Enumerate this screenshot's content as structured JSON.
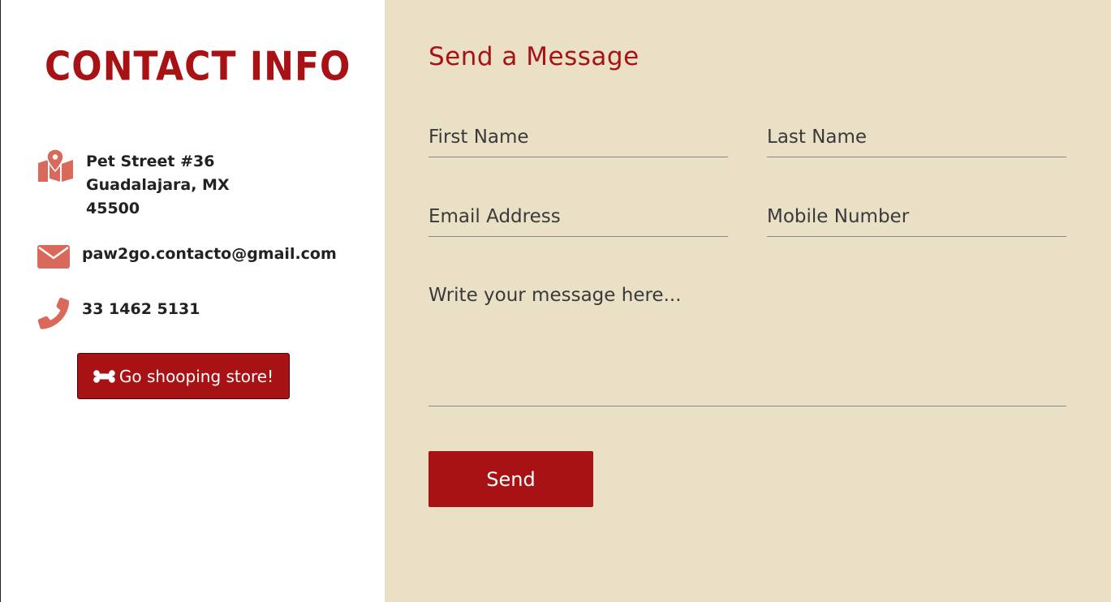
{
  "contact": {
    "title": "CONTACT INFO",
    "address_line1": "Pet Street #36",
    "address_line2": "Guadalajara, MX",
    "address_line3": "45500",
    "email": "paw2go.contacto@gmail.com",
    "phone": "33 1462 5131",
    "shop_button_label": "Go shooping store!",
    "icons": {
      "address": "map-pin-icon",
      "email": "envelope-icon",
      "phone": "phone-icon",
      "shop": "bone-icon"
    }
  },
  "form": {
    "title": "Send a Message",
    "first_name_placeholder": "First Name",
    "last_name_placeholder": "Last Name",
    "email_placeholder": "Email Address",
    "mobile_placeholder": "Mobile Number",
    "message_placeholder": "Write your message here...",
    "send_label": "Send"
  },
  "colors": {
    "brand_red": "#a81214",
    "icon_salmon": "#d9695a",
    "form_background": "#e9e0c5"
  }
}
